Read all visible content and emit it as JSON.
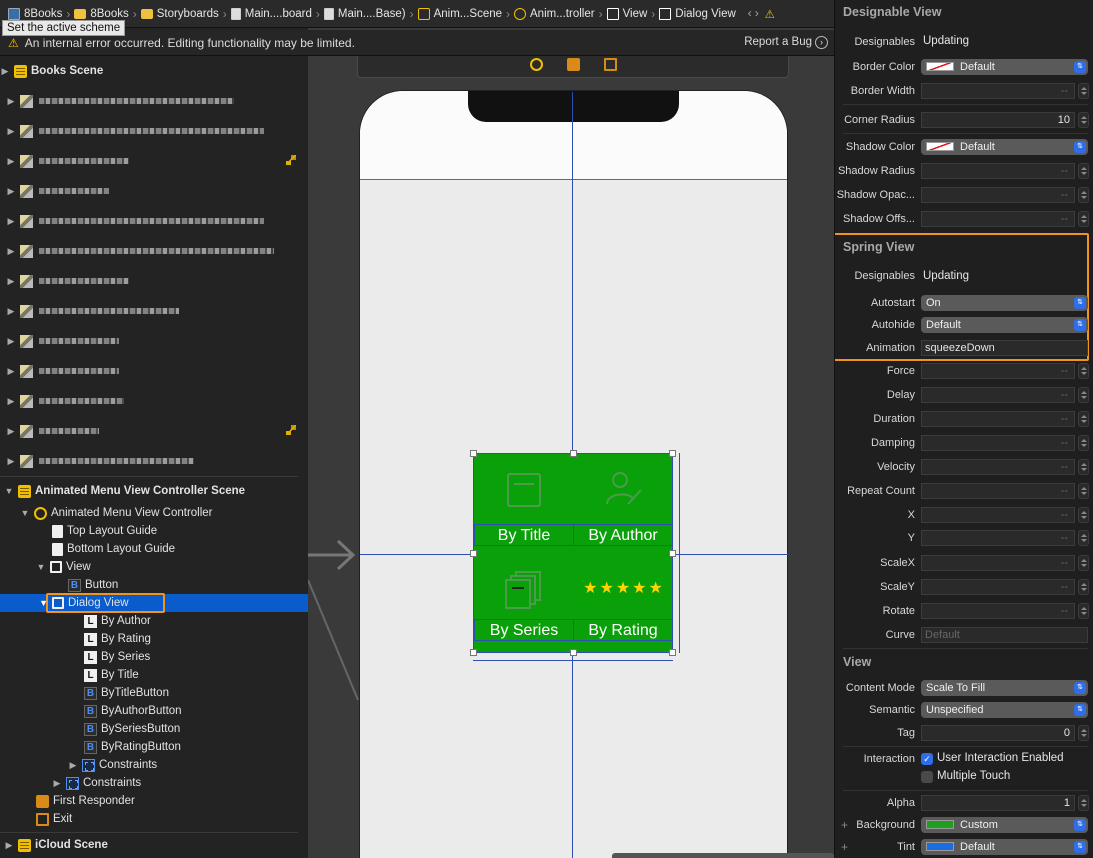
{
  "jumpbar": {
    "items": [
      "8Books",
      "8Books",
      "Storyboards",
      "Main....board",
      "Main....Base)",
      "Anim...Scene",
      "Anim...troller",
      "View",
      "Dialog View"
    ],
    "nav": "‹ ›",
    "warning": "⚠"
  },
  "tooltip": "Set the active scheme",
  "errorbar": {
    "message": "An internal error occurred. Editing functionality may be limited.",
    "report": "Report a Bug"
  },
  "outline": {
    "books_scene": "Books Scene",
    "animated_scene": "Animated Menu View Controller Scene",
    "vc": "Animated Menu View Controller",
    "top_guide": "Top Layout Guide",
    "bottom_guide": "Bottom Layout Guide",
    "view": "View",
    "button": "Button",
    "dialog_view": "Dialog View",
    "labels": [
      "By Author",
      "By Rating",
      "By Series",
      "By Title"
    ],
    "buttons": [
      "ByTitleButton",
      "ByAuthorButton",
      "BySeriesButton",
      "ByRatingButton"
    ],
    "constraints_inner": "Constraints",
    "constraints_outer": "Constraints",
    "first_responder": "First Responder",
    "exit": "Exit",
    "icloud_scene": "iCloud Scene"
  },
  "canvas": {
    "cells": [
      "By Title",
      "By Author",
      "By Series",
      "By Rating"
    ],
    "stars": "★★★★★",
    "dialog_color": "#0aa00a"
  },
  "inspector": {
    "designable_view": {
      "title": "Designable View",
      "designables_label": "Designables",
      "designables_value": "Updating",
      "border_color_label": "Border Color",
      "border_color_value": "Default",
      "border_width_label": "Border Width",
      "corner_radius_label": "Corner Radius",
      "corner_radius_value": "10",
      "shadow_color_label": "Shadow Color",
      "shadow_color_value": "Default",
      "shadow_radius_label": "Shadow Radius",
      "shadow_opacity_label": "Shadow Opac...",
      "shadow_offset_label": "Shadow Offs..."
    },
    "spring_view": {
      "title": "Spring View",
      "designables_label": "Designables",
      "designables_value": "Updating",
      "autostart_label": "Autostart",
      "autostart_value": "On",
      "autohide_label": "Autohide",
      "autohide_value": "Default",
      "animation_label": "Animation",
      "animation_value": "squeezeDown",
      "force_label": "Force",
      "delay_label": "Delay",
      "duration_label": "Duration",
      "damping_label": "Damping",
      "velocity_label": "Velocity",
      "repeat_label": "Repeat Count",
      "x_label": "X",
      "y_label": "Y",
      "scalex_label": "ScaleX",
      "scaley_label": "ScaleY",
      "rotate_label": "Rotate",
      "curve_label": "Curve",
      "curve_placeholder": "Default"
    },
    "view": {
      "title": "View",
      "content_mode_label": "Content Mode",
      "content_mode_value": "Scale To Fill",
      "semantic_label": "Semantic",
      "semantic_value": "Unspecified",
      "tag_label": "Tag",
      "tag_value": "0",
      "interaction_label": "Interaction",
      "user_interaction": "User Interaction Enabled",
      "multiple_touch": "Multiple Touch",
      "alpha_label": "Alpha",
      "alpha_value": "1",
      "background_label": "Background",
      "background_value": "Custom",
      "background_color": "#1f9e1f",
      "tint_label": "Tint",
      "tint_value": "Default",
      "tint_color": "#1a6ee0"
    },
    "empty_value": "--",
    "accent_color": "#f0941e"
  }
}
